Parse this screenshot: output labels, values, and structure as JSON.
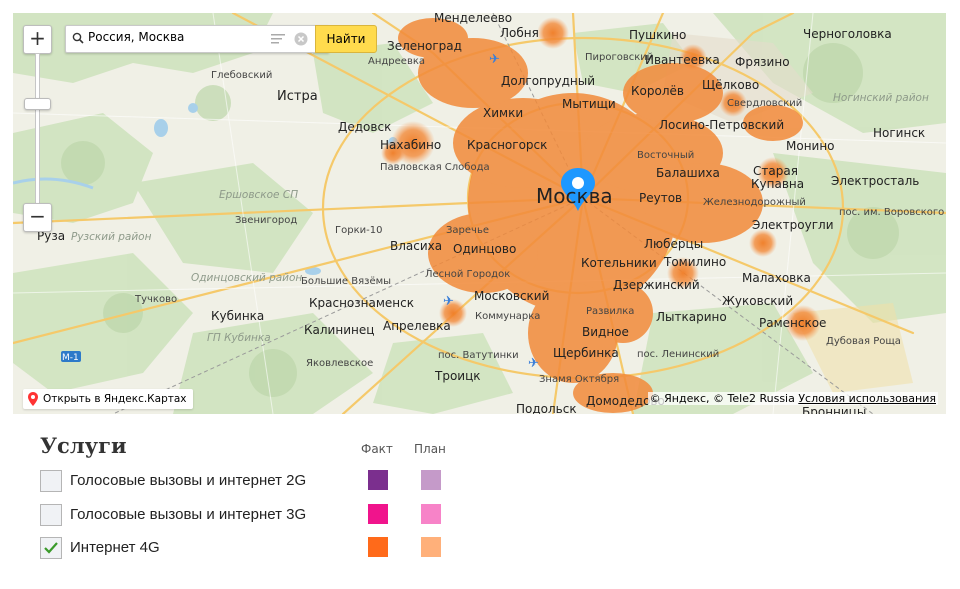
{
  "search": {
    "value": "Россия, Москва",
    "find_label": "Найти"
  },
  "zoom": {
    "in_label": "+",
    "out_label": "−"
  },
  "map": {
    "open_link": "Открыть в Яндекс.Картах",
    "copyright": "© Яндекс, © Tele2 Russia",
    "terms": "Условия использования",
    "labels": {
      "moskva": "Москва",
      "zelenograd": "Зеленоград",
      "lobnya": "Лобня",
      "pushkino": "Пушкино",
      "chernogolovka": "Черноголовка",
      "mendeleevo": "Менделеево",
      "pirogovsky": "Пироговский",
      "ivanteevka": "Ивантеевка",
      "andreevka": "Андреевка",
      "dolgoprudny": "Долгопрудный",
      "fryazino": "Фрязино",
      "glebovsky": "Глебовский",
      "istra": "Истра",
      "khimki": "Химки",
      "mytishchi": "Мытищи",
      "korolev": "Королёв",
      "shchelkovo": "Щёлково",
      "sverdlovsky": "Свердловский",
      "noginsky": "Ногинский район",
      "dedovsk": "Дедовск",
      "losino": "Лосино-Петровский",
      "noginsk": "Ногинск",
      "nakhabino": "Нахабино",
      "krasnogorsk": "Красногорск",
      "vostochny": "Восточный",
      "monino": "Монино",
      "pavlovskaya": "Павловская Слобода",
      "balashikha": "Балашиха",
      "staraya": "Старая",
      "kupavna": "Купавна",
      "elektrostal": "Электросталь",
      "ershovskoe": "Ершовское СП",
      "reutov": "Реутов",
      "zheleznodorozhny": "Железнодорожный",
      "vorovskogo": "пос. им. Воровского",
      "zvenigorod": "Звенигород",
      "gorki10": "Горки-10",
      "zarechye": "Заречье",
      "elektrougli": "Электроугли",
      "ruza": "Руза",
      "ruzsky": "Рузский район",
      "vlasikha": "Власиха",
      "odintsovo": "Одинцово",
      "lyubertsy": "Люберцы",
      "odintsovsky": "Одинцовский район",
      "bolshie": "Большие Вязёмы",
      "lesnoy": "Лесной Городок",
      "kotelniki": "Котельники",
      "tomilino": "Томилино",
      "malakhovka": "Малаховка",
      "tuchkovo": "Тучково",
      "krasnoznamensk": "Краснознаменск",
      "moskovsky": "Московский",
      "dzerzhinsky": "Дзержинский",
      "zhukovsky": "Жуковский",
      "kubinka": "Кубинка",
      "kommunarka": "Коммунарка",
      "razvilka": "Развилка",
      "lytkarino": "Лыткарино",
      "ramenskoe": "Раменское",
      "gp_kubinka": "ГП Кубинка",
      "kalininets": "Калининец",
      "aprelevka": "Апрелевка",
      "vidnoe": "Видное",
      "dubovaya": "Дубовая Роща",
      "m1": "М-1",
      "vatutinki": "пос. Ватутинки",
      "shcherbinka": "Щербинка",
      "leninsky": "пос. Ленинский",
      "yakovlevskoe": "Яковлевское",
      "troitsk": "Троицк",
      "znamya": "Знамя Октября",
      "podolsk": "Подольск",
      "domodedovo": "Домодедово",
      "bronnitsy": "Бронницы"
    }
  },
  "legend": {
    "title": "Услуги",
    "col_fact": "Факт",
    "col_plan": "План",
    "rows": [
      {
        "label": "Голосовые вызовы и интернет 2G",
        "checked": false,
        "fact_color": "#7b2f8e",
        "plan_color": "#c59ac9"
      },
      {
        "label": "Голосовые вызовы и интернет 3G",
        "checked": false,
        "fact_color": "#f0148c",
        "plan_color": "#f783c8"
      },
      {
        "label": "Интернет 4G",
        "checked": true,
        "fact_color": "#ff6a1a",
        "plan_color": "#ffb07a"
      }
    ]
  },
  "icons": [
    "search-icon",
    "menu-icon",
    "clear-icon",
    "location-pin-icon",
    "yandex-pin-icon",
    "airport-icon",
    "checkmark-icon"
  ]
}
